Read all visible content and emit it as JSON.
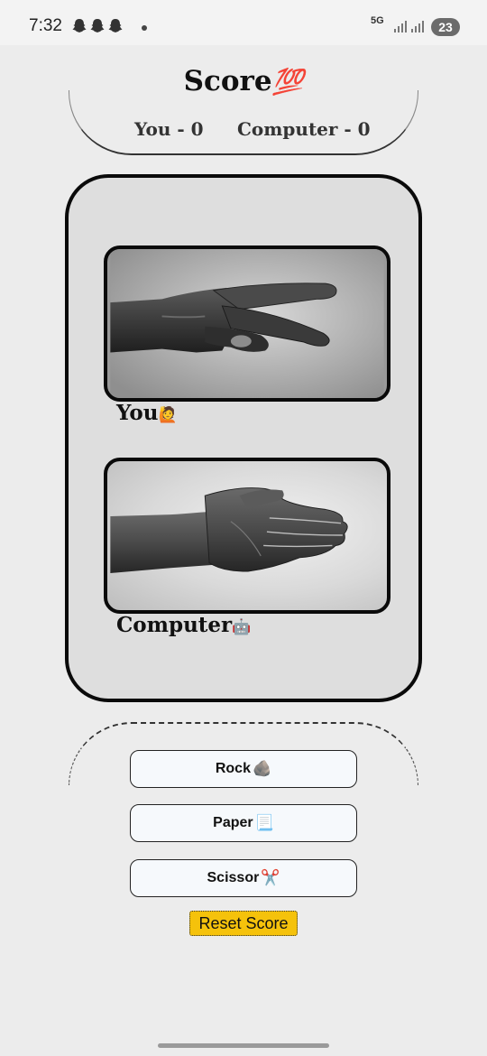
{
  "status_bar": {
    "time": "7:32",
    "battery": "23",
    "network": "5G"
  },
  "score": {
    "title": "Score",
    "title_emoji": "💯",
    "you": "You - 0",
    "computer": "Computer - 0"
  },
  "game": {
    "player_label": "You",
    "player_emoji": "🙋",
    "player_choice": "scissor",
    "computer_label": "Computer",
    "computer_emoji": "🤖",
    "computer_choice": "paper"
  },
  "controls": {
    "rock_label": "Rock",
    "rock_emoji": "🪨",
    "paper_label": "Paper",
    "paper_emoji": "📃",
    "scissor_label": "Scissor",
    "scissor_emoji": "✂️",
    "reset_label": "Reset Score"
  },
  "colors": {
    "reset_button": "#f5c20b",
    "card_background": "#dedede",
    "button_background": "#f6f9fc"
  }
}
